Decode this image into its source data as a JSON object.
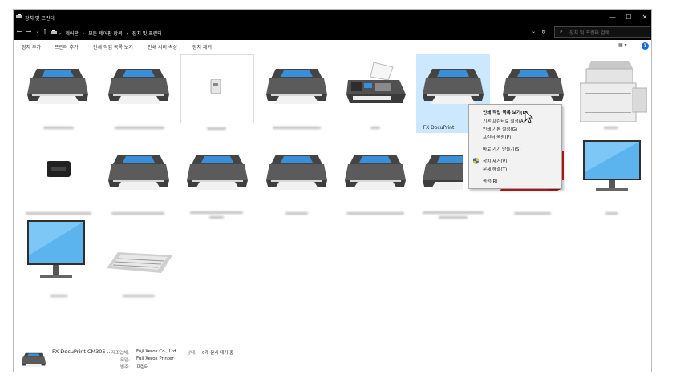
{
  "window": {
    "title": "장치 및 프린터",
    "controls": {
      "minimize": "—",
      "maximize": "☐",
      "close": "✕"
    }
  },
  "address_bar": {
    "back": "←",
    "forward": "→",
    "recent": "⌄",
    "up": "↑",
    "crumbs": [
      "제어판",
      "모든 제어판 항목",
      "장치 및 프린터"
    ],
    "separator": "›",
    "dropdown": "⌄",
    "refresh": "↻",
    "search_placeholder": "장치 및 프린터 검색"
  },
  "toolbar": {
    "items": [
      "장치 추가",
      "프린터 추가",
      "인쇄 작업 목록 보기",
      "인쇄 서버 속성",
      "장치 제거"
    ],
    "view_label": "▦ ▾",
    "help_label": "?"
  },
  "devices": [
    {
      "label": ""
    },
    {
      "label": ""
    },
    {
      "label": ""
    },
    {
      "label": ""
    },
    {
      "label": ""
    },
    {
      "label": "FX DocuPrint"
    },
    {
      "label": ""
    },
    {
      "label": ""
    },
    {
      "label": ""
    },
    {
      "label": ""
    },
    {
      "label": ""
    },
    {
      "label": ""
    },
    {
      "label": ""
    },
    {
      "label": ""
    },
    {
      "label": ""
    },
    {
      "label": ""
    },
    {
      "label": ""
    },
    {
      "label": ""
    }
  ],
  "context_menu": {
    "items": [
      "인쇄 작업 목록 보기(E)",
      "기본 프린터로 설정(A)",
      "인쇄 기본 설정(G)",
      "프린터 속성(P)",
      "바로 가기 만들기(S)",
      "장치 제거(V)",
      "문제 해결(T)",
      "속성(R)"
    ]
  },
  "status_bar": {
    "device_name": "FX DocuPrint CM305 ...",
    "manufacturer_key": "제조업체:",
    "manufacturer_value": "Fuji Xerox Co., Ltd.",
    "model_key": "모델:",
    "model_value": "Fuji Xerox Printer",
    "category_key": "범주:",
    "category_value": "프린터",
    "state_key": "상태:",
    "state_value": "0개 문서 대기 중"
  },
  "colors": {
    "titlebar": "#000000",
    "selection": "#cce8ff",
    "accent": "#1a6fd4"
  }
}
